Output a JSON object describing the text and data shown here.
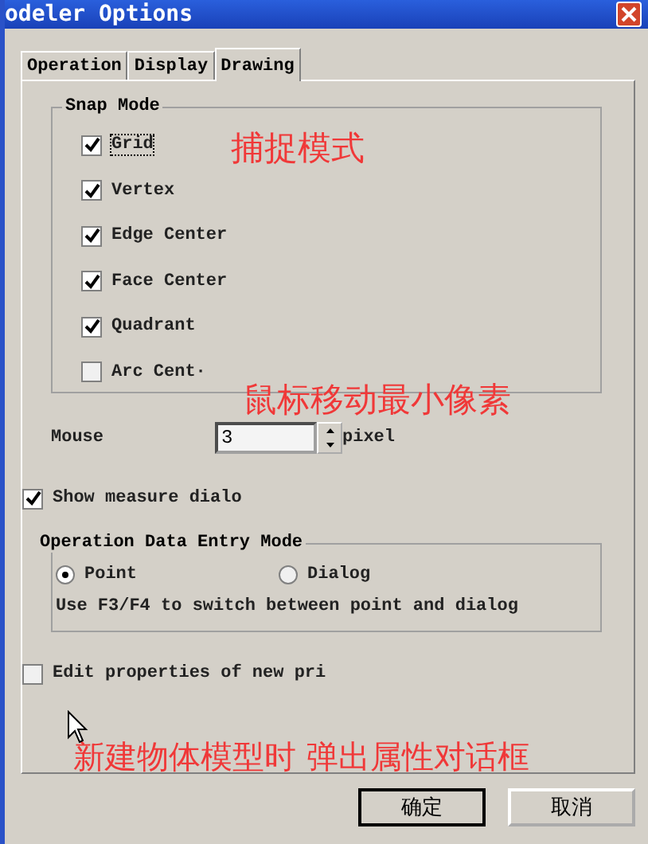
{
  "window": {
    "title": "odeler Options"
  },
  "tabs": [
    {
      "label": "Operation",
      "selected": false
    },
    {
      "label": "Display",
      "selected": false
    },
    {
      "label": "Drawing",
      "selected": true
    }
  ],
  "snap_mode": {
    "title": "Snap Mode",
    "items": [
      {
        "label": "Grid",
        "checked": true,
        "focused": true
      },
      {
        "label": "Vertex",
        "checked": true,
        "focused": false
      },
      {
        "label": "Edge Center",
        "checked": true,
        "focused": false
      },
      {
        "label": "Face Center",
        "checked": true,
        "focused": false
      },
      {
        "label": "Quadrant",
        "checked": true,
        "focused": false
      },
      {
        "label": "Arc Cent·",
        "checked": false,
        "focused": false
      }
    ]
  },
  "mouse": {
    "label": "Mouse",
    "value": "3",
    "unit": "pixel"
  },
  "show_measure": {
    "label": "Show measure dialo",
    "checked": true
  },
  "entry_mode": {
    "title": "Operation Data Entry Mode",
    "options": [
      {
        "label": "Point",
        "selected": true
      },
      {
        "label": "Dialog",
        "selected": false
      }
    ],
    "hint": "Use F3/F4 to switch between point and dialog"
  },
  "edit_properties": {
    "label": "Edit properties of new pri",
    "checked": false
  },
  "annotations": [
    "捕捉模式",
    "鼠标移动最小像素",
    "新建物体模型时  弹出属性对话框"
  ],
  "buttons": [
    "确定",
    "取消"
  ]
}
